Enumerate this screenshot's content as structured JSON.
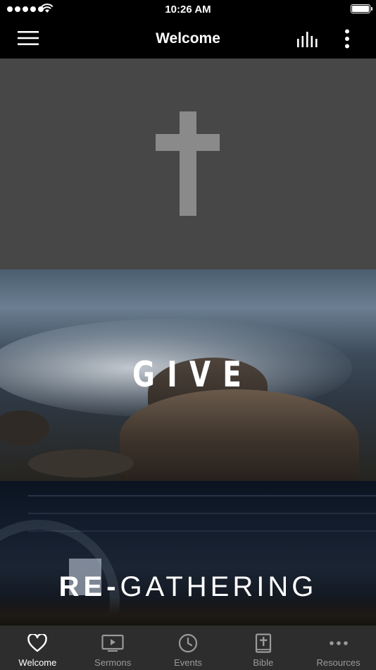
{
  "status_bar": {
    "time": "10:26 AM"
  },
  "header": {
    "title": "Welcome"
  },
  "banners": {
    "give": {
      "label": "GIVE"
    },
    "regathering": {
      "label_bold": "RE-",
      "label_light": "GATHERING"
    }
  },
  "tabs": [
    {
      "label": "Welcome",
      "icon": "heart-icon",
      "active": true
    },
    {
      "label": "Sermons",
      "icon": "video-icon",
      "active": false
    },
    {
      "label": "Events",
      "icon": "clock-icon",
      "active": false
    },
    {
      "label": "Bible",
      "icon": "bible-icon",
      "active": false
    },
    {
      "label": "Resources",
      "icon": "more-dots-icon",
      "active": false
    }
  ],
  "colors": {
    "bar_background": "#000000",
    "tab_background": "#2d2d2d",
    "hero_background": "#474747",
    "cross": "#8a8a8a"
  }
}
